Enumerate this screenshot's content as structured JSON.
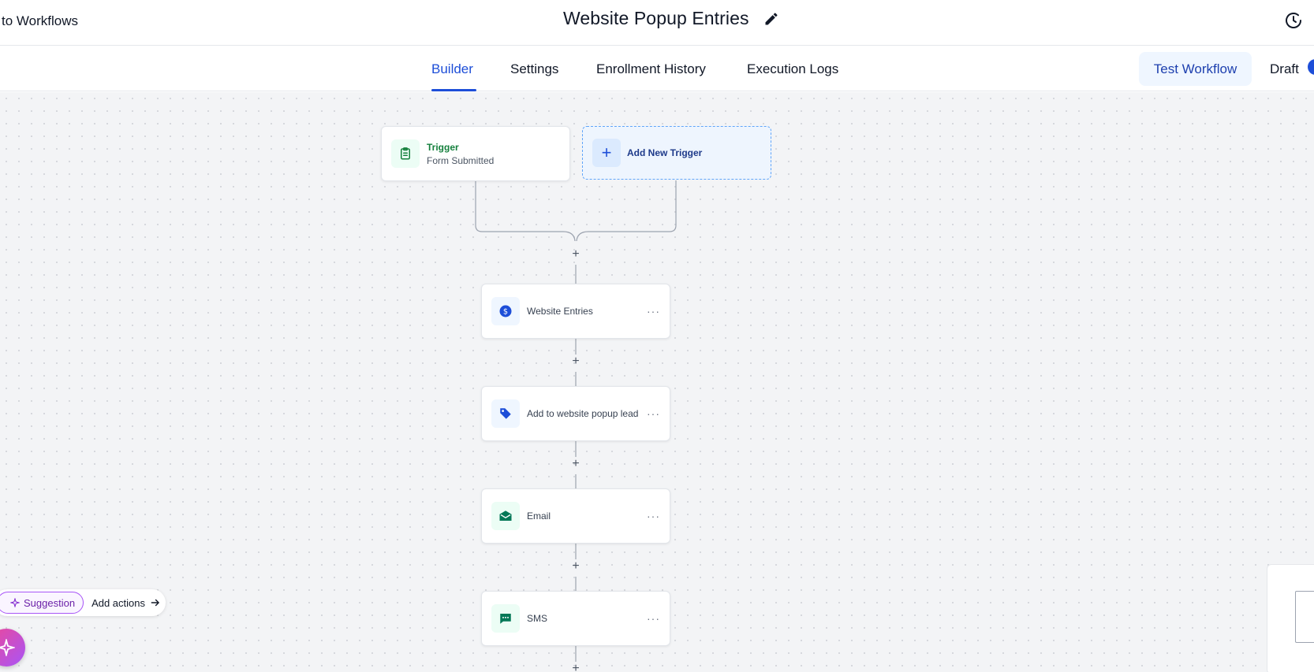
{
  "header": {
    "back_label": "to Workflows",
    "title": "Website Popup Entries"
  },
  "tabs": [
    {
      "label": "Builder",
      "active": true
    },
    {
      "label": "Settings",
      "active": false
    },
    {
      "label": "Enrollment History",
      "active": false
    },
    {
      "label": "Execution Logs",
      "active": false
    }
  ],
  "actions": {
    "test_label": "Test Workflow",
    "status_label": "Draft"
  },
  "trigger": {
    "title": "Trigger",
    "subtitle": "Form Submitted",
    "icon": "clipboard-icon"
  },
  "add_trigger": {
    "label": "Add New Trigger"
  },
  "steps": [
    {
      "label": "Website Entries",
      "icon": "dollar-icon",
      "color": "#1d4ed8"
    },
    {
      "label": "Add to website popup lead",
      "icon": "tag-icon",
      "color": "#1d4ed8"
    },
    {
      "label": "Email",
      "icon": "email-icon",
      "color": "#047857"
    },
    {
      "label": "SMS",
      "icon": "sms-icon",
      "color": "#047857"
    }
  ],
  "suggestion": {
    "chip_label": "Suggestion",
    "action_label": "Add actions"
  },
  "colors": {
    "accent": "#1d4ed8",
    "trigger_green": "#15803d",
    "suggestion_purple": "#a855f7"
  }
}
